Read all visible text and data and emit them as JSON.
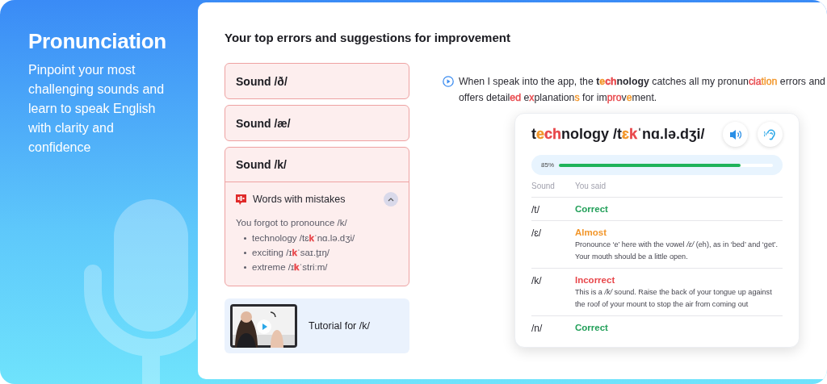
{
  "sidebar": {
    "title": "Pronunciation",
    "description": "Pinpoint your most challenging sounds and learn to speak English with clarity and confidence"
  },
  "heading": "Your top errors and suggestions for improvement",
  "sounds": [
    {
      "label": "Sound /ð/",
      "expanded": false
    },
    {
      "label": "Sound /æ/",
      "expanded": false
    },
    {
      "label": "Sound /k/",
      "expanded": true,
      "mistakes": {
        "title": "Words with mistakes",
        "expanded": true,
        "intro": "You forgot to pronounce /k/",
        "words": [
          {
            "parts": [
              {
                "text": "technology /tɛ"
              },
              {
                "text": "k",
                "color": "#e8474b"
              },
              {
                "text": "ˈnɑ.lə.dʒi/"
              }
            ]
          },
          {
            "parts": [
              {
                "text": "exciting /ɪ"
              },
              {
                "text": "k",
                "color": "#e8474b"
              },
              {
                "text": "ˈsaɪ.t̬ɪŋ/"
              }
            ]
          },
          {
            "parts": [
              {
                "text": "extreme /ɪ"
              },
              {
                "text": "k",
                "color": "#e8474b"
              },
              {
                "text": "ˈstriːm/"
              }
            ]
          }
        ]
      }
    }
  ],
  "tutorial": {
    "label": "Tutorial for /k/"
  },
  "example": {
    "sentence": [
      {
        "text": "When I speak into the app, the ",
        "bold": false
      },
      {
        "text": "t",
        "bold": true
      },
      {
        "text": "e",
        "color": "#f2962a",
        "bold": true
      },
      {
        "text": "ch",
        "color": "#e8474b",
        "bold": true
      },
      {
        "text": "nology",
        "bold": true
      },
      {
        "text": " catches all my pronun",
        "bold": false
      },
      {
        "text": "cia",
        "color": "#e8474b",
        "bold": false
      },
      {
        "text": "tion",
        "color": "#f2962a",
        "bold": false
      },
      {
        "text": " errors and offers detail",
        "bold": false
      },
      {
        "text": "ed",
        "color": "#e8474b",
        "bold": false
      },
      {
        "text": " e",
        "bold": false
      },
      {
        "text": "x",
        "color": "#e8474b",
        "bold": false
      },
      {
        "text": "planation",
        "bold": false
      },
      {
        "text": "s",
        "color": "#f2962a",
        "bold": false
      },
      {
        "text": " for im",
        "bold": false
      },
      {
        "text": "pro",
        "color": "#e8474b",
        "bold": false
      },
      {
        "text": "v",
        "bold": false
      },
      {
        "text": "e",
        "color": "#f2962a",
        "bold": false
      },
      {
        "text": "ment.",
        "bold": false
      }
    ]
  },
  "word_card": {
    "title": [
      {
        "text": "t"
      },
      {
        "text": "e",
        "color": "#f2962a"
      },
      {
        "text": "ch",
        "color": "#e8474b"
      },
      {
        "text": "nology /t"
      },
      {
        "text": "ɛ",
        "color": "#f2962a"
      },
      {
        "text": "k",
        "color": "#e8474b"
      },
      {
        "text": "ˈnɑ.lə.dʒi/"
      }
    ],
    "score": {
      "reading": "85%",
      "level": 0.85
    },
    "columns": [
      "Sound",
      "You said"
    ],
    "rows": [
      {
        "sound": "/t/",
        "result": "Correct",
        "kind": "correct"
      },
      {
        "sound": "/ɛ/",
        "result": "Almost",
        "kind": "almost",
        "explanation": "Pronounce ‘e’ here with the vowel */ɛ/* (eh), as in ‘bed’ and ‘get’. Your mouth should be a little open."
      },
      {
        "sound": "/k/",
        "result": "Incorrect",
        "kind": "incorrect",
        "explanation": "This is a */k/* sound. Raise the back of your tongue up against the roof of your mount to stop the air from coming out"
      },
      {
        "sound": "/n/",
        "result": "Correct",
        "kind": "correct"
      }
    ]
  }
}
